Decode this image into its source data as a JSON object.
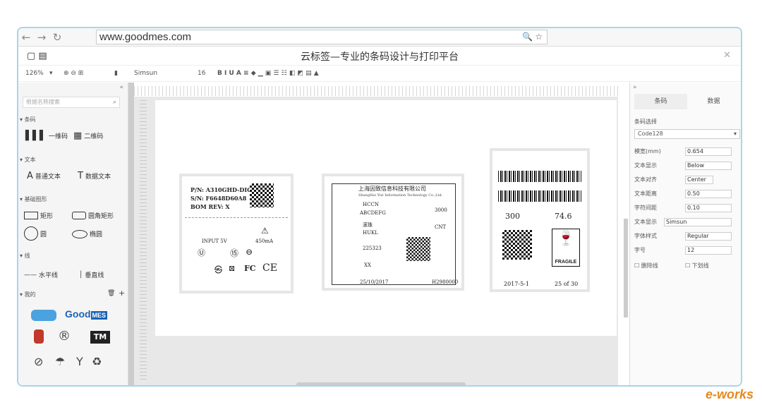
{
  "browser": {
    "url": "www.goodmes.com"
  },
  "app": {
    "title": "云标签—专业的条码设计与打印平台"
  },
  "toolbar": {
    "zoom": "126%",
    "font": "Simsun",
    "font_size": "16"
  },
  "left_panel": {
    "search_placeholder": "根据名称搜索",
    "sections": {
      "barcode": "条码",
      "text": "文本",
      "shapes": "基础图形",
      "lines": "线",
      "mine": "我的"
    },
    "items": {
      "barcode_1d": "一维码",
      "barcode_2d": "二维码",
      "plain_text": "普通文本",
      "data_text": "数据文本",
      "rect": "矩形",
      "round_rect": "圆角矩形",
      "circle": "圆",
      "ellipse": "椭圆",
      "hline": "水平线",
      "vline": "垂直线"
    }
  },
  "label1": {
    "pn": "P/N: A310GHD-DIO",
    "sn": "S/N: F6648D60A8",
    "bom": "BOM REV: X",
    "input": "INPUT 5V",
    "current": "450mA"
  },
  "label2": {
    "company_cn": "上海因致信息科技有限公司",
    "company_en": "ShangHai Yizi Information Technology Co.,Ltd.",
    "dest_code": "HCCN",
    "dest": "ABCDEFG",
    "pack": "3000",
    "desc": "滚珠",
    "desc_en": "HUKL",
    "supplier": "CNT",
    "ref": "225323",
    "cmd": "XX",
    "date": "25/10/2017",
    "lot": "H2980000"
  },
  "label3": {
    "qty": "300",
    "weight": "74.6",
    "fragile": "FRAGILE",
    "date": "2017-5-1",
    "count": "25 of 30"
  },
  "right_panel": {
    "tab_barcode": "条码",
    "tab_data": "数据",
    "select_label": "条码选择",
    "code_type": "Code128",
    "rows": [
      {
        "label": "模宽(mm)",
        "value": "0.654"
      },
      {
        "label": "文本显示",
        "value": "Below"
      },
      {
        "label": "文本对齐",
        "value": "Center"
      },
      {
        "label": "文本距离",
        "value": "0.50"
      },
      {
        "label": "字符间距",
        "value": "0.10"
      },
      {
        "label": "文本显示",
        "value": "Simsun"
      },
      {
        "label": "字体样式",
        "value": "Regular"
      },
      {
        "label": "字号",
        "value": "12"
      }
    ],
    "strike": "删除线",
    "underline": "下划线"
  },
  "watermark": "e-works"
}
